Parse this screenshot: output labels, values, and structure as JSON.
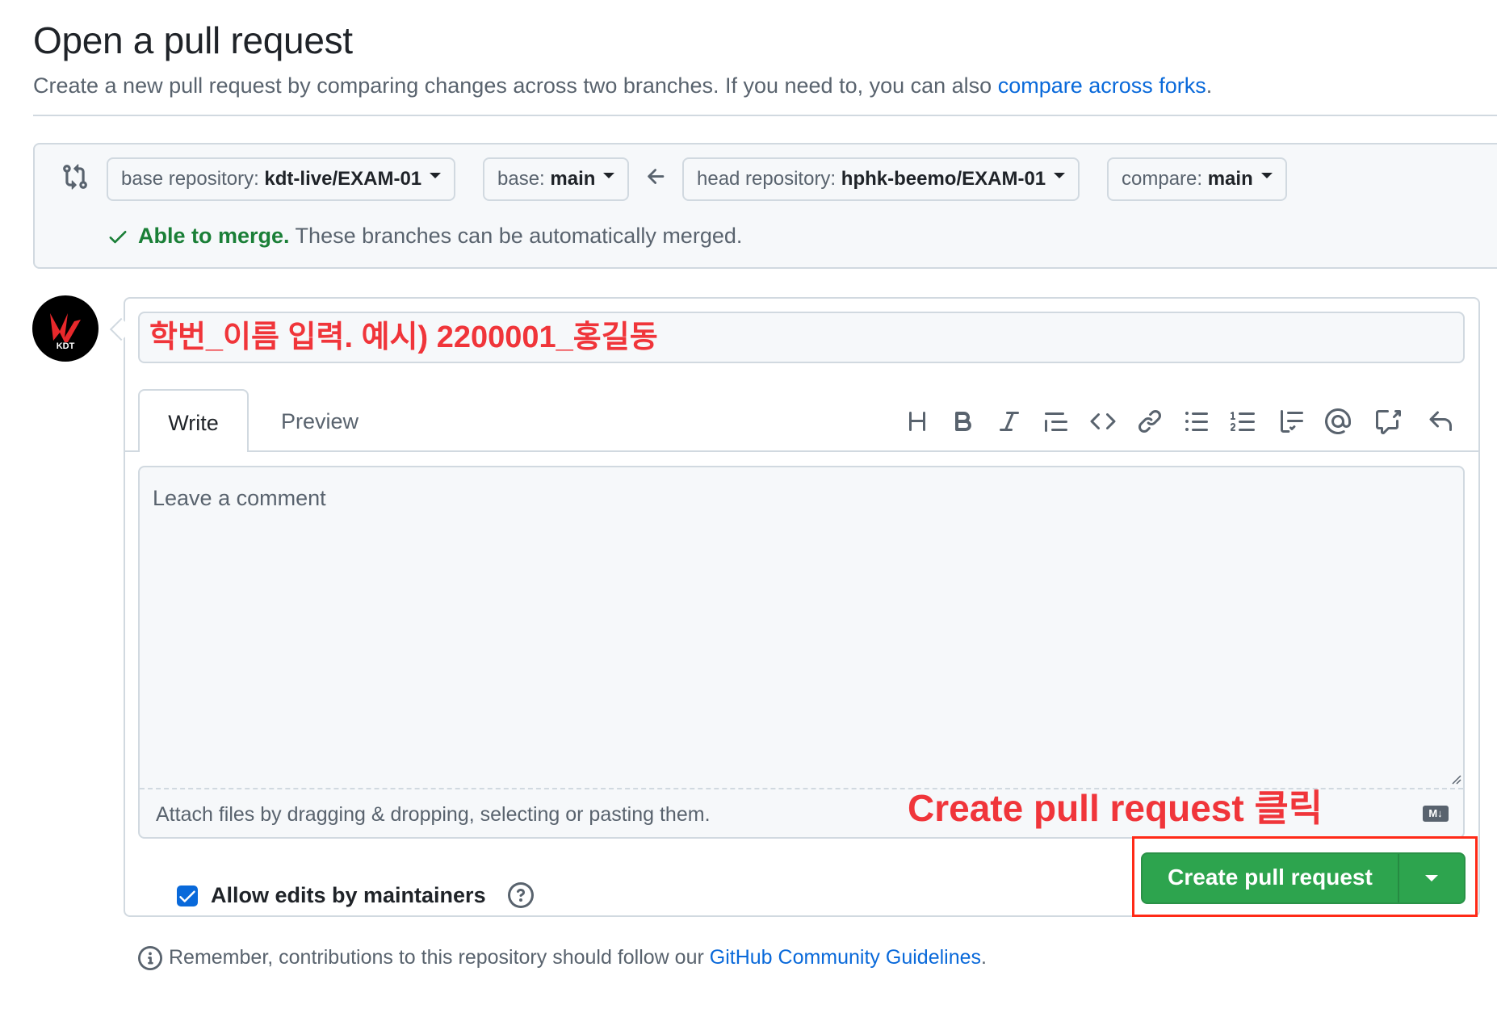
{
  "header": {
    "title": "Open a pull request",
    "subtitle_prefix": "Create a new pull request by comparing changes across two branches. If you need to, you can also ",
    "subtitle_link": "compare across forks",
    "subtitle_suffix": "."
  },
  "compare": {
    "base_repo_label": "base repository: ",
    "base_repo_value": "kdt-live/EXAM-01",
    "base_label": "base: ",
    "base_value": "main",
    "head_repo_label": "head repository: ",
    "head_repo_value": "hphk-beemo/EXAM-01",
    "compare_label": "compare: ",
    "compare_value": "main",
    "merge_status": "Able to merge.",
    "merge_message": " These branches can be automatically merged."
  },
  "avatar": {
    "text": "KDT"
  },
  "form": {
    "title_value": "학번_이름 입력.  예시) 2200001_홍길동",
    "tabs": [
      "Write",
      "Preview"
    ],
    "comment_placeholder": "Leave a comment",
    "attach_hint": "Attach files by dragging & dropping, selecting or pasting them.",
    "markdown_badge": "M↓",
    "allow_edits_label": "Allow edits by maintainers",
    "allow_edits_checked": true,
    "submit_label": "Create pull request"
  },
  "toolbar": [
    "heading-icon",
    "bold-icon",
    "italic-icon",
    "quote-icon",
    "code-icon",
    "link-icon",
    "unordered-list-icon",
    "ordered-list-icon",
    "task-list-icon",
    "mention-icon",
    "reference-icon",
    "undo-icon"
  ],
  "annotation": {
    "text": "Create pull request 클릭"
  },
  "footer": {
    "prefix": "Remember, contributions to this repository should follow our ",
    "link": "GitHub Community Guidelines",
    "suffix": "."
  },
  "colors": {
    "accent": "#0969da",
    "success": "#1a7f37",
    "primary_button": "#2da44e",
    "annotation_red": "#f0353a"
  }
}
